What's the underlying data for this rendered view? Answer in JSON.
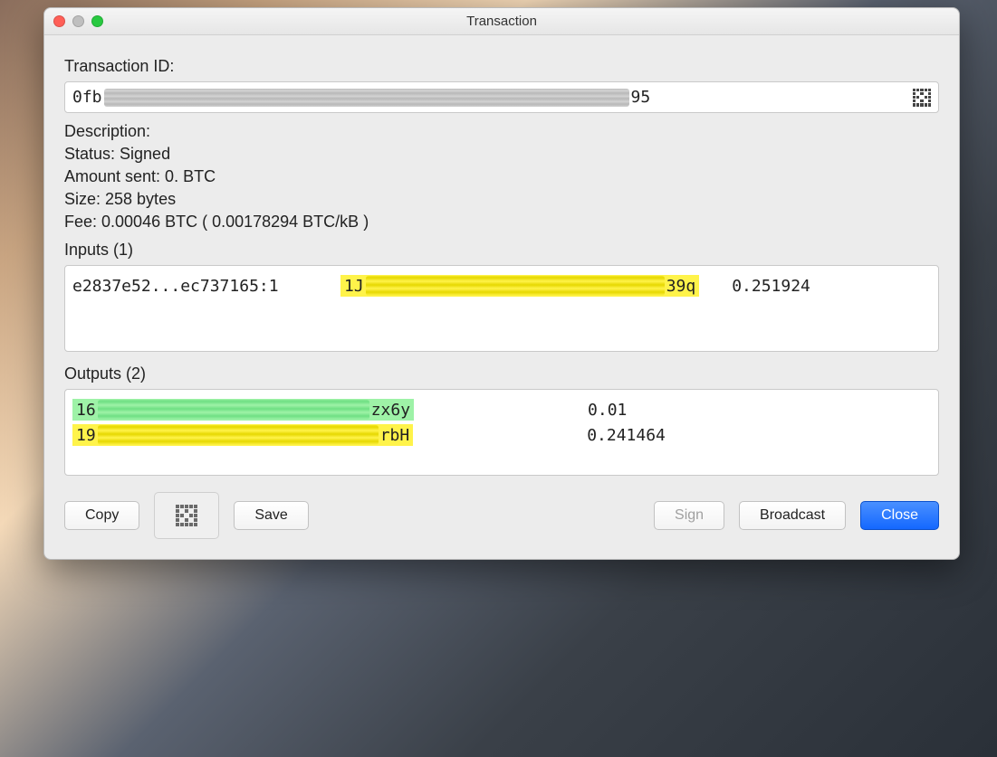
{
  "window": {
    "title": "Transaction"
  },
  "labels": {
    "txid": "Transaction ID:",
    "description": "Description:",
    "inputs": "Inputs (1)",
    "outputs": "Outputs (2)"
  },
  "txid": {
    "prefix": "0fb",
    "suffix": "95"
  },
  "status_line": "Status: Signed",
  "amount_line": "Amount sent: 0. BTC",
  "size_line": "Size: 258 bytes",
  "fee_line": "Fee: 0.00046 BTC  ( 0.00178294 BTC/kB )",
  "inputs": [
    {
      "txref": "e2837e52...ec737165:1",
      "addr_prefix": "1J",
      "addr_suffix": "39q",
      "addr_highlight": "yellow",
      "amount": "0.251924"
    }
  ],
  "outputs": [
    {
      "addr_prefix": "16",
      "addr_suffix": "zx6y",
      "addr_highlight": "green",
      "amount": "0.01"
    },
    {
      "addr_prefix": "19",
      "addr_suffix": "rbH",
      "addr_highlight": "yellow",
      "amount": "0.241464"
    }
  ],
  "buttons": {
    "copy": "Copy",
    "save": "Save",
    "sign": "Sign",
    "broadcast": "Broadcast",
    "close": "Close"
  }
}
